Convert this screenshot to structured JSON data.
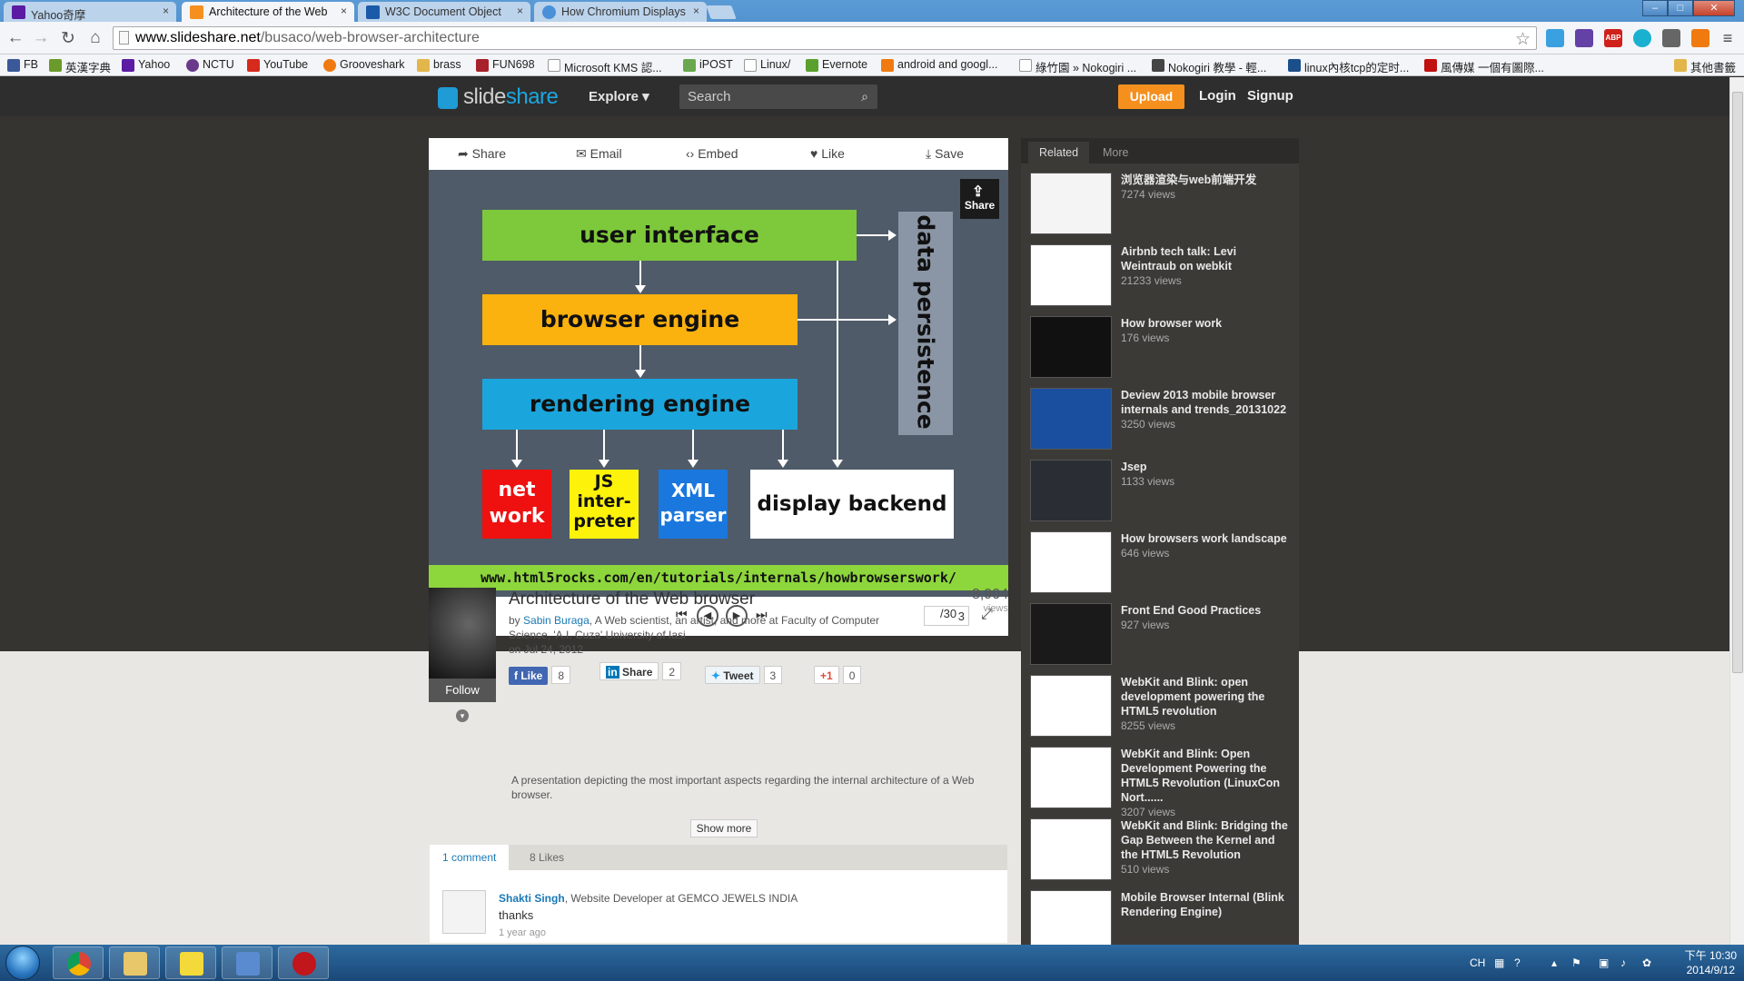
{
  "browser": {
    "tabs": [
      {
        "title": "Yahoo奇摩",
        "favicon": "yahoo-icon",
        "color": "#5b1ca3"
      },
      {
        "title": "Architecture of the Web",
        "favicon": "slideshare-icon",
        "color": "#f5901e"
      },
      {
        "title": "W3C Document Object",
        "favicon": "w3c-icon",
        "color": "#1a5aa8"
      },
      {
        "title": "How Chromium Displays",
        "favicon": "chromium-icon",
        "color": "#4a90d9"
      }
    ],
    "tab_close": "×",
    "url_domain": "www.slideshare.net",
    "url_path": "/busaco/web-browser-architecture",
    "win_min": "–",
    "win_max": "□",
    "win_close": "✕",
    "back": "←",
    "forward": "→",
    "reload": "↻",
    "home": "⌂",
    "star": "☆",
    "menu": "≡",
    "ext_abp_badge": "ABP"
  },
  "bookmarks": [
    {
      "label": "FB",
      "color": "#3b5998"
    },
    {
      "label": "英漢字典",
      "color": "#6a9a2a"
    },
    {
      "label": "Yahoo",
      "color": "#5b1ca3"
    },
    {
      "label": "NCTU",
      "color": "#6a3a8a"
    },
    {
      "label": "YouTube",
      "color": "#d62a1d"
    },
    {
      "label": "Grooveshark",
      "color": "#f07a10"
    },
    {
      "label": "brass",
      "color": "#e2b64a"
    },
    {
      "label": "FUN698",
      "color": "#a8202a"
    },
    {
      "label": "Microsoft KMS 認...",
      "color": "#cccccc"
    },
    {
      "label": "iPOST",
      "color": "#6aa84f"
    },
    {
      "label": "Linux/",
      "color": "#cccccc"
    },
    {
      "label": "Evernote",
      "color": "#5aa02c"
    },
    {
      "label": "android and googl...",
      "color": "#f07a10"
    },
    {
      "label": "綠竹園 » Nokogiri ...",
      "color": "#cccccc"
    },
    {
      "label": "Nokogiri 教學 - 輕...",
      "color": "#444444"
    },
    {
      "label": "linux內核tcp的定时...",
      "color": "#1a4f8a"
    },
    {
      "label": "風傳媒 一個有圖際...",
      "color": "#c01010"
    }
  ],
  "other_bookmarks": "其他書籤",
  "slideshare": {
    "logo_prefix": "slide",
    "logo_suffix": "share",
    "explore": "Explore ▾",
    "search_placeholder": "Search",
    "upload": "Upload",
    "login": "Login",
    "signup": "Signup"
  },
  "player": {
    "share": "Share",
    "email": "Email",
    "embed": "Embed",
    "like": "Like",
    "save": "Save",
    "share_overlay": "Share",
    "page_current": "3",
    "page_total": "/30"
  },
  "slide": {
    "user_interface": "user interface",
    "browser_engine": "browser engine",
    "rendering_engine": "rendering engine",
    "data_persistence": "data persistence",
    "network": "net\nwork",
    "js": "JS\ninter-\npreter",
    "xml": "XML\nparser",
    "display": "display backend",
    "url": "www.html5rocks.com/en/tutorials/internals/howbrowserswork/",
    "colors": {
      "ui": "#7dc93b",
      "engine": "#fbb10e",
      "render": "#1aa6dc",
      "persist": "#8a95a5",
      "network": "#ef1010",
      "js": "#fdf20a",
      "xml": "#1a77de",
      "display": "#ffffff"
    }
  },
  "presentation": {
    "title": "Architecture of the Web browser",
    "by": "by",
    "author": "Sabin Buraga",
    "author_desc": ", A Web scientist, an artist, and more at Faculty of Computer Science, 'A.I. Cuza' University of Iasi",
    "date": "on Jul 24, 2012",
    "views": "8,904",
    "views_label": "views",
    "follow": "Follow",
    "like_label": "Like",
    "like_count": "8",
    "share_label": "Share",
    "share_count": "2",
    "tweet_label": "Tweet",
    "tweet_count": "3",
    "gplus_label": "+1",
    "gplus_count": "0",
    "description": "A presentation depicting the most important aspects regarding the internal architecture of a Web browser.",
    "show_more": "Show more"
  },
  "comments": {
    "tab_comments": "1 comment",
    "tab_likes": "8 Likes",
    "items": [
      {
        "name": "Shakti Singh",
        "role": ", Website Developer at GEMCO JEWELS INDIA",
        "text": "thanks",
        "time": "1 year ago"
      }
    ]
  },
  "sidebar": {
    "tab_related": "Related",
    "tab_more": "More",
    "items": [
      {
        "title": "浏览器渲染与web前端开发",
        "views": "7274 views"
      },
      {
        "title": "Airbnb tech talk: Levi Weintraub on webkit",
        "views": "21233 views"
      },
      {
        "title": "How browser work",
        "views": "176 views"
      },
      {
        "title": "Deview 2013 mobile browser internals and trends_20131022",
        "views": "3250 views"
      },
      {
        "title": "Jsep",
        "views": "1133 views"
      },
      {
        "title": "How browsers work landscape",
        "views": "646 views"
      },
      {
        "title": "Front End Good Practices",
        "views": "927 views"
      },
      {
        "title": "WebKit and Blink: open development powering the HTML5 revolution",
        "views": "8255 views"
      },
      {
        "title": "WebKit and Blink: Open Development Powering the HTML5 Revolution (LinuxCon Nort......",
        "views": "3207 views"
      },
      {
        "title": "WebKit and Blink: Bridging the Gap Between the Kernel and the HTML5 Revolution",
        "views": "510 views"
      },
      {
        "title": "Mobile Browser Internal (Blink Rendering Engine)",
        "views": ""
      }
    ]
  },
  "taskbar": {
    "lang": "CH",
    "time": "下午 10:30",
    "date": "2014/9/12"
  }
}
